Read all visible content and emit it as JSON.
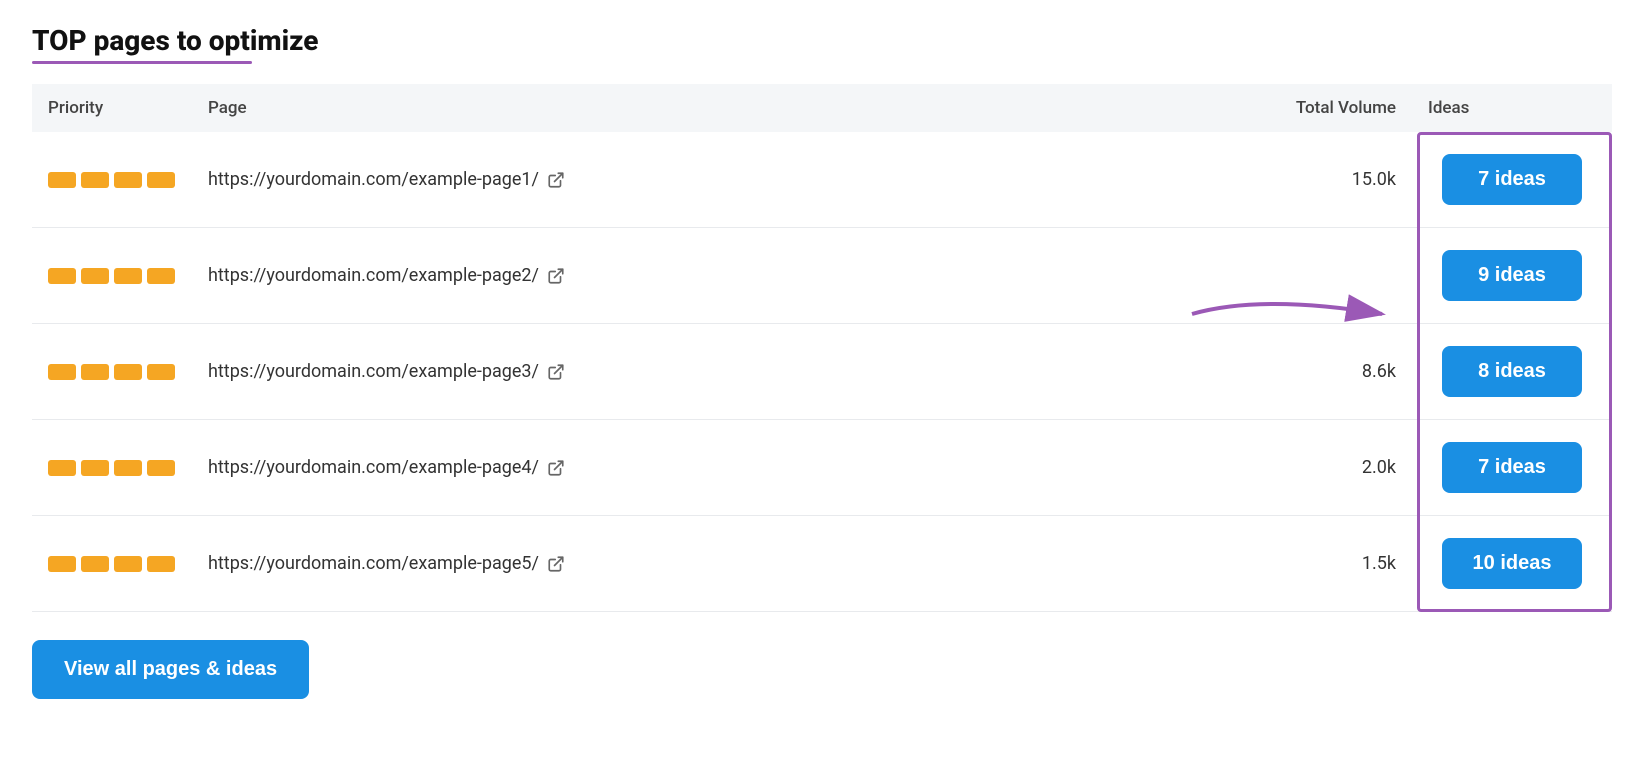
{
  "title": "TOP pages to optimize",
  "columns": {
    "priority": "Priority",
    "page": "Page",
    "volume": "Total Volume",
    "ideas": "Ideas"
  },
  "rows": [
    {
      "id": 1,
      "priority_bars": 4,
      "url": "https://yourdomain.com/example-page1/",
      "volume": "15.0k",
      "ideas_label": "7 ideas",
      "has_volume": true
    },
    {
      "id": 2,
      "priority_bars": 4,
      "url": "https://yourdomain.com/example-page2/",
      "volume": "",
      "ideas_label": "9 ideas",
      "has_volume": false,
      "has_arrow": true
    },
    {
      "id": 3,
      "priority_bars": 4,
      "url": "https://yourdomain.com/example-page3/",
      "volume": "8.6k",
      "ideas_label": "8 ideas",
      "has_volume": true
    },
    {
      "id": 4,
      "priority_bars": 4,
      "url": "https://yourdomain.com/example-page4/",
      "volume": "2.0k",
      "ideas_label": "7 ideas",
      "has_volume": true
    },
    {
      "id": 5,
      "priority_bars": 4,
      "url": "https://yourdomain.com/example-page5/",
      "volume": "1.5k",
      "ideas_label": "10 ideas",
      "has_volume": true
    }
  ],
  "view_all_label": "View all pages & ideas",
  "accent_color": "#9b59b6",
  "ideas_btn_color": "#1a8fe3",
  "priority_bar_color": "#f5a623"
}
